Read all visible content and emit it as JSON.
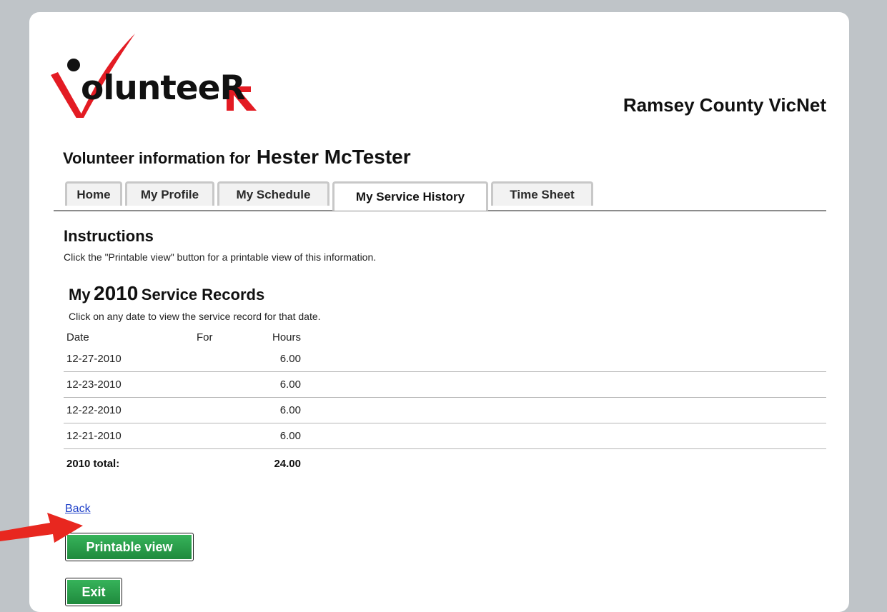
{
  "header": {
    "logo_text": "olunteeR",
    "org_name": "Ramsey County VicNet"
  },
  "volunteer": {
    "heading_prefix": "Volunteer information for",
    "name": "Hester McTester"
  },
  "tabs": [
    {
      "label": "Home",
      "active": false
    },
    {
      "label": "My Profile",
      "active": false
    },
    {
      "label": "My Schedule",
      "active": false
    },
    {
      "label": "My Service History",
      "active": true
    },
    {
      "label": "Time Sheet",
      "active": false
    }
  ],
  "instructions": {
    "title": "Instructions",
    "text": "Click the \"Printable view\" button for a printable view of this information."
  },
  "records": {
    "title_prefix": "My",
    "year": "2010",
    "title_suffix": "Service Records",
    "subtitle": "Click on any date to view the service record for that date.",
    "columns": {
      "date": "Date",
      "for": "For",
      "hours": "Hours"
    },
    "rows": [
      {
        "date": "12-27-2010",
        "for": "",
        "hours": "6.00"
      },
      {
        "date": "12-23-2010",
        "for": "",
        "hours": "6.00"
      },
      {
        "date": "12-22-2010",
        "for": "",
        "hours": "6.00"
      },
      {
        "date": "12-21-2010",
        "for": "",
        "hours": "6.00"
      }
    ],
    "total_label": "2010 total:",
    "total_hours": "24.00"
  },
  "actions": {
    "back_label": "Back",
    "printable_label": "Printable view",
    "exit_label": "Exit"
  },
  "colors": {
    "background": "#bfc4c8",
    "link": "#1d3fc8",
    "button_green": "#2a9e4b",
    "arrow_red": "#e8271f",
    "logo_red": "#e31b23"
  },
  "icons": {
    "arrow": "red-pointer-arrow-icon",
    "logo": "volunteer-logo"
  }
}
